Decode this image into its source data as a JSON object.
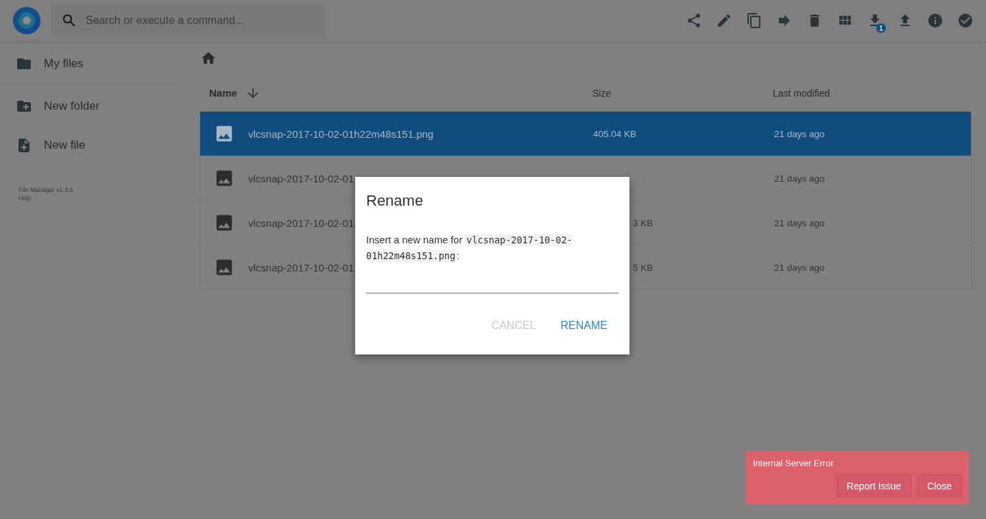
{
  "search": {
    "placeholder": "Search or execute a command..."
  },
  "toolbar": {
    "actions": [
      {
        "kind": "share"
      },
      {
        "kind": "edit"
      },
      {
        "kind": "copy"
      },
      {
        "kind": "move"
      },
      {
        "kind": "delete"
      },
      {
        "kind": "grid"
      },
      {
        "kind": "download",
        "badge": "1"
      },
      {
        "kind": "upload"
      },
      {
        "kind": "info"
      },
      {
        "kind": "select"
      }
    ]
  },
  "sidebar": {
    "items": [
      {
        "label": "My files",
        "kind": "folder"
      },
      {
        "label": "New folder",
        "kind": "new-folder"
      },
      {
        "label": "New file",
        "kind": "new-file"
      }
    ],
    "footer": [
      "File Manager v1.3.6",
      "Help"
    ]
  },
  "table": {
    "columns": [
      "Name",
      "Size",
      "Last modified"
    ],
    "rows": [
      {
        "name": "vlcsnap-2017-10-02-01h22m48s151.png",
        "size": "405.04 KB",
        "modified": "21 days ago",
        "selected": true
      },
      {
        "name": "vlcsnap-2017-10-02-01",
        "modified": "21 days ago",
        "selected": false
      },
      {
        "name": "vlcsnap-2017-10-02-01",
        "size": "3 KB",
        "modified": "21 days ago",
        "selected": false
      },
      {
        "name": "vlcsnap-2017-10-02-01",
        "size": "5 KB",
        "modified": "21 days ago",
        "selected": false
      }
    ]
  },
  "dialog": {
    "title": "Rename",
    "message": "Insert a new name for ",
    "filename": "vlcsnap-2017-10-02-01h22m48s151.png",
    "suffix": ":",
    "buttons": [
      {
        "label": "CANCEL",
        "disabled": true
      },
      {
        "label": "RENAME",
        "disabled": false
      }
    ]
  },
  "toast": {
    "message": "Internal Server Error",
    "buttons": [
      "Report Issue",
      "Close"
    ]
  }
}
